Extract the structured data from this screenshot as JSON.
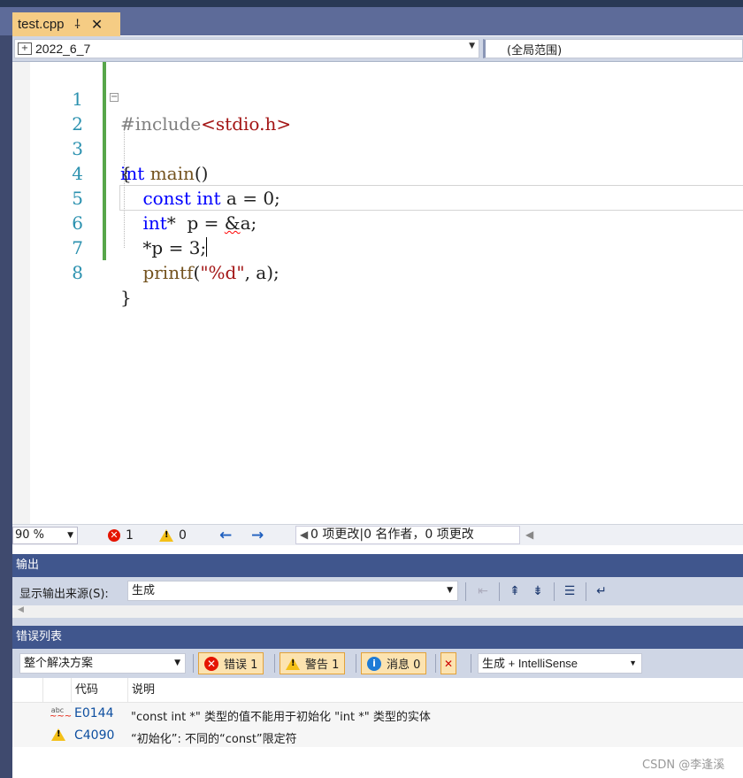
{
  "tab": {
    "filename": "test.cpp",
    "pin_glyph": "⸸",
    "close_glyph": "✕"
  },
  "navbar": {
    "project": "2022_6_7",
    "scope": "(全局范围)"
  },
  "editor": {
    "line_numbers": [
      "1",
      "2",
      "3",
      "4",
      "5",
      "6",
      "7",
      "8"
    ]
  },
  "status": {
    "zoom": "90 %",
    "error_count": "1",
    "warning_count": "0",
    "changes": "0 项更改|0 名作者，0 项更改"
  },
  "output": {
    "title": "输出",
    "source_label": "显示输出来源(S):",
    "source_value": "生成"
  },
  "error_list": {
    "title": "错误列表",
    "scope": "整个解决方案",
    "errors_btn": "错误 1",
    "warnings_btn": "警告 1",
    "messages_btn": "消息 0",
    "build_filter": "生成 + IntelliSense",
    "col_code": "代码",
    "col_desc": "说明",
    "rows": [
      {
        "icon": "intellisense-error-icon",
        "code": "E0144",
        "desc": "\"const int *\" 类型的值不能用于初始化 \"int *\" 类型的实体"
      },
      {
        "icon": "warning-icon",
        "code": "C4090",
        "desc": "“初始化”: 不同的“const”限定符"
      }
    ]
  },
  "watermark": "CSDN @李逢溪",
  "colors": {
    "frame": "#40568d",
    "tab_active": "#f5cc84",
    "filter_btn": "#fce3b0",
    "error": "#e51400",
    "warning": "#f4c018"
  }
}
